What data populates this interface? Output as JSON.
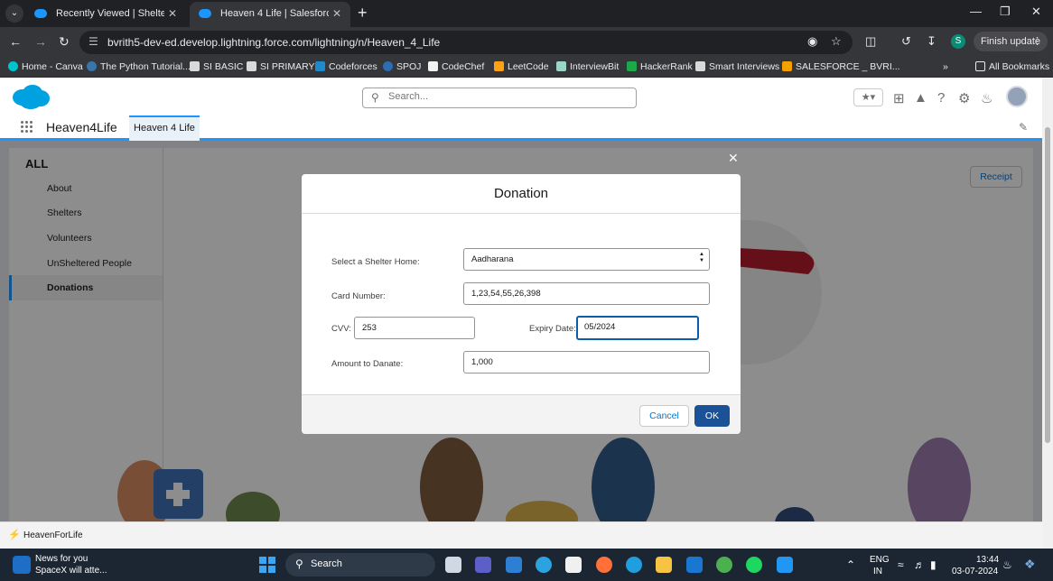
{
  "browser": {
    "tabs": [
      {
        "title": "Recently Viewed | Shelters | Sal...",
        "active": false
      },
      {
        "title": "Heaven 4 Life | Salesforce",
        "active": true
      }
    ],
    "url": "bvrith5-dev-ed.develop.lightning.force.com/lightning/n/Heaven_4_Life",
    "profile_initial": "S",
    "finish_update_label": "Finish update",
    "bookmarks": [
      {
        "label": "Home - Canva",
        "color": "#00c4cc"
      },
      {
        "label": "The Python Tutorial...",
        "color": "#3776ab"
      },
      {
        "label": "SI BASIC",
        "color": "#d9d9d9"
      },
      {
        "label": "SI PRIMARY",
        "color": "#d9d9d9"
      },
      {
        "label": "Codeforces",
        "color": "#1f8acb"
      },
      {
        "label": "SPOJ",
        "color": "#2e6db4"
      },
      {
        "label": "CodeChef",
        "color": "#f2f2f2"
      },
      {
        "label": "LeetCode",
        "color": "#ffa116"
      },
      {
        "label": "InterviewBit",
        "color": "#9bd5c8"
      },
      {
        "label": "HackerRank",
        "color": "#1ba94c"
      },
      {
        "label": "Smart Interviews",
        "color": "#d9d9d9"
      },
      {
        "label": "SALESFORCE _ BVRI...",
        "color": "#f4a100"
      }
    ],
    "all_bookmarks_label": "All Bookmarks"
  },
  "sf": {
    "search_placeholder": "Search...",
    "app_name": "Heaven4Life",
    "nav_tab": "Heaven 4 Life",
    "sidebar": {
      "header": "ALL",
      "items": [
        {
          "label": "About",
          "selected": false
        },
        {
          "label": "Shelters",
          "selected": false
        },
        {
          "label": "Volunteers",
          "selected": false
        },
        {
          "label": "UnSheltered People",
          "selected": false
        },
        {
          "label": "Donations",
          "selected": true
        }
      ]
    },
    "receipt_label": "Receipt",
    "utility_label": "HeavenForLife"
  },
  "modal": {
    "title": "Donation",
    "shelter_label": "Select a Shelter Home:",
    "shelter_value": "Aadharana",
    "card_label": "Card Number:",
    "card_value": "1,23,54,55,26,398",
    "cvv_label": "CVV:",
    "cvv_value": "253",
    "expiry_label": "Expiry Date:",
    "expiry_value": "05/2024",
    "amount_label": "Amount to Danate:",
    "amount_value": "1,000",
    "cancel_label": "Cancel",
    "ok_label": "OK"
  },
  "taskbar": {
    "news_title": "News for you",
    "news_sub": "SpaceX will atte...",
    "search_label": "Search",
    "lang": "ENG",
    "region": "IN",
    "time": "13:44",
    "date": "03-07-2024"
  },
  "colors": {
    "sf_blue": "#1b96ff",
    "brand_button": "#1b5297",
    "link": "#0176d3"
  }
}
